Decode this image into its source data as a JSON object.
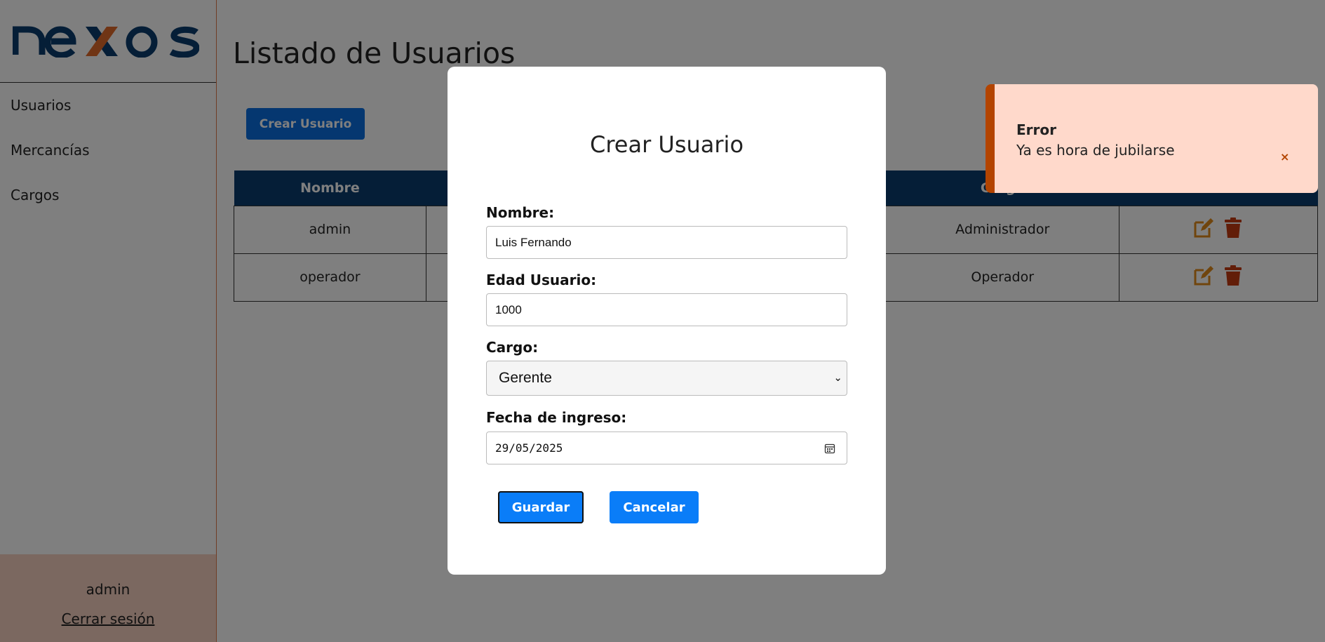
{
  "brand": {
    "logo_text": "nexos",
    "accent_color": "#e06a2a",
    "primary_color": "#0b3d6e"
  },
  "sidebar": {
    "items": [
      {
        "label": "Usuarios"
      },
      {
        "label": "Mercancías"
      },
      {
        "label": "Cargos"
      }
    ],
    "user": {
      "name": "admin",
      "logout_label": "Cerrar sesión"
    }
  },
  "main": {
    "title": "Listado de Usuarios",
    "create_button": "Crear Usuario",
    "table": {
      "headers": [
        "Nombre",
        "",
        "Cargo",
        ""
      ],
      "rows": [
        {
          "nombre": "admin",
          "cargo": "Administrador"
        },
        {
          "nombre": "operador",
          "cargo": "Operador"
        }
      ]
    }
  },
  "modal": {
    "title": "Crear Usuario",
    "fields": {
      "nombre": {
        "label": "Nombre:",
        "value": "Luis Fernando"
      },
      "edad": {
        "label": "Edad Usuario:",
        "value": "1000"
      },
      "cargo": {
        "label": "Cargo:",
        "value": "Gerente"
      },
      "fecha": {
        "label": "Fecha de ingreso:",
        "value": "29/05/2025"
      }
    },
    "save_label": "Guardar",
    "cancel_label": "Cancelar"
  },
  "toast": {
    "title": "Error",
    "message": "Ya es hora de jubilarse",
    "close_symbol": "×"
  },
  "icons": [
    "edit-icon",
    "trash-icon",
    "calendar-icon",
    "chevron-down-icon",
    "close-icon"
  ]
}
